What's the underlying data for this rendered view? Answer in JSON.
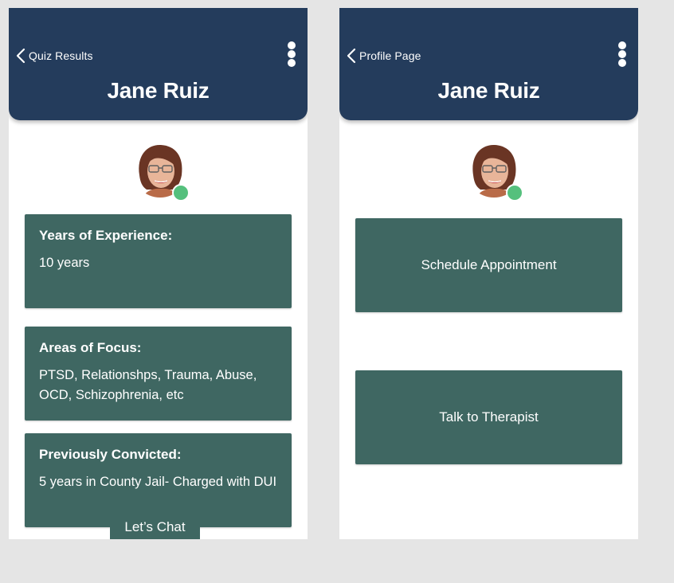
{
  "left_screen": {
    "back_label": "Quiz Results",
    "title": "Jane Ruiz",
    "cards": [
      {
        "title": "Years of Experience:",
        "body": "10 years"
      },
      {
        "title": "Areas of Focus:",
        "body": "PTSD, Relationshps, Trauma, Abuse, OCD, Schizophrenia, etc"
      },
      {
        "title": "Previously Convicted:",
        "body": "5 years in County Jail- Charged with DUI"
      }
    ],
    "chat_button": "Let’s Chat"
  },
  "right_screen": {
    "back_label": "Profile Page",
    "title": "Jane Ruiz",
    "schedule_button": "Schedule Appointment",
    "talk_button": "Talk to Therapist"
  },
  "icons": {
    "back": "chevron-left-icon",
    "menu": "more-vertical-icon",
    "status": "online-status-icon"
  },
  "colors": {
    "header": "#243c5c",
    "card": "#3f6762",
    "status_online": "#55c07d",
    "background": "#e5e5e5"
  }
}
